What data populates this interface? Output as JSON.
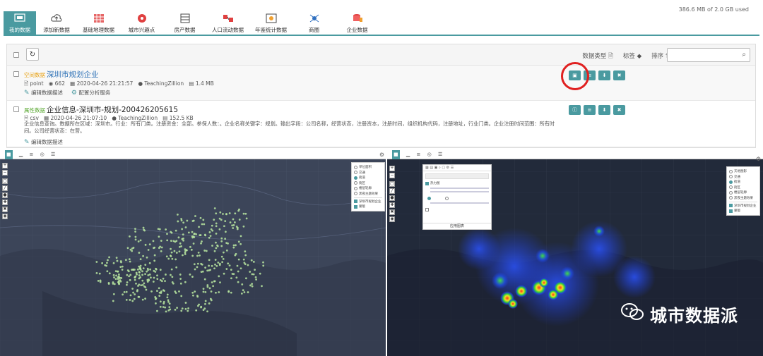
{
  "header": {
    "quota": "386.6 MB of 2.0 GB used"
  },
  "tabs": [
    {
      "label": "我的数据",
      "icon": "database-icon",
      "active": true
    },
    {
      "label": "添加新数据",
      "icon": "cloud-upload-icon"
    },
    {
      "label": "基础地理数据",
      "icon": "map-grid-icon"
    },
    {
      "label": "城市兴趣点",
      "icon": "poi-pin-icon"
    },
    {
      "label": "房产数据",
      "icon": "building-icon"
    },
    {
      "label": "人口流动数据",
      "icon": "population-flow-icon"
    },
    {
      "label": "年鉴统计数据",
      "icon": "yearbook-chart-icon"
    },
    {
      "label": "商圈",
      "icon": "business-district-icon"
    },
    {
      "label": "企业数据",
      "icon": "enterprise-db-icon"
    }
  ],
  "toolbar": {
    "data_type": "数据类型",
    "tag": "标签",
    "sort": "排序",
    "search_placeholder": ""
  },
  "items": [
    {
      "type_tag": "空间数据",
      "type_color": "#e8a317",
      "title": "深圳市规划企业",
      "format": "point",
      "count": "662",
      "date": "2020-04-26 21:21:57",
      "owner": "TeachingZillion",
      "size": "1.4 MB",
      "link1": "编辑数据描述",
      "link2": "配置分析服务"
    },
    {
      "type_tag": "属性数据",
      "type_color": "#5aa832",
      "title": "企业信息-深圳市-规划-200426205615",
      "format": "csv",
      "date": "2020-04-26 21:07:10",
      "owner": "TeachingZillion",
      "size": "152.5 KB",
      "description": "企业信息查询。数据所在区域：深圳市。行业：所有门类。注册资金：全部。参保人数：。企业名称关键字：规划。输出字段：公司名称，经营状态，注册资本，注册时间，组织机构代码，注册地址，行业门类。企业注册时间范围：所有时间。公司经营状态：在营。",
      "link1": "编辑数据描述"
    }
  ],
  "map_left": {
    "layers": [
      "单位面积",
      "交通",
      "街道",
      "街区",
      "楼层轮廓",
      "黑夜主题效果"
    ],
    "selected": 2,
    "checks": [
      "深圳市规划企业",
      "蒙版"
    ]
  },
  "map_right": {
    "layers": [
      "天地图影",
      "交通",
      "街道",
      "街区",
      "楼层轮廓",
      "黑夜主题效果"
    ],
    "selected": 2,
    "checks": [
      "深圳市规划企业",
      "蒙版"
    ],
    "panel_title": "热力图",
    "panel_button": "应用图表"
  },
  "watermark": "城市数据派"
}
